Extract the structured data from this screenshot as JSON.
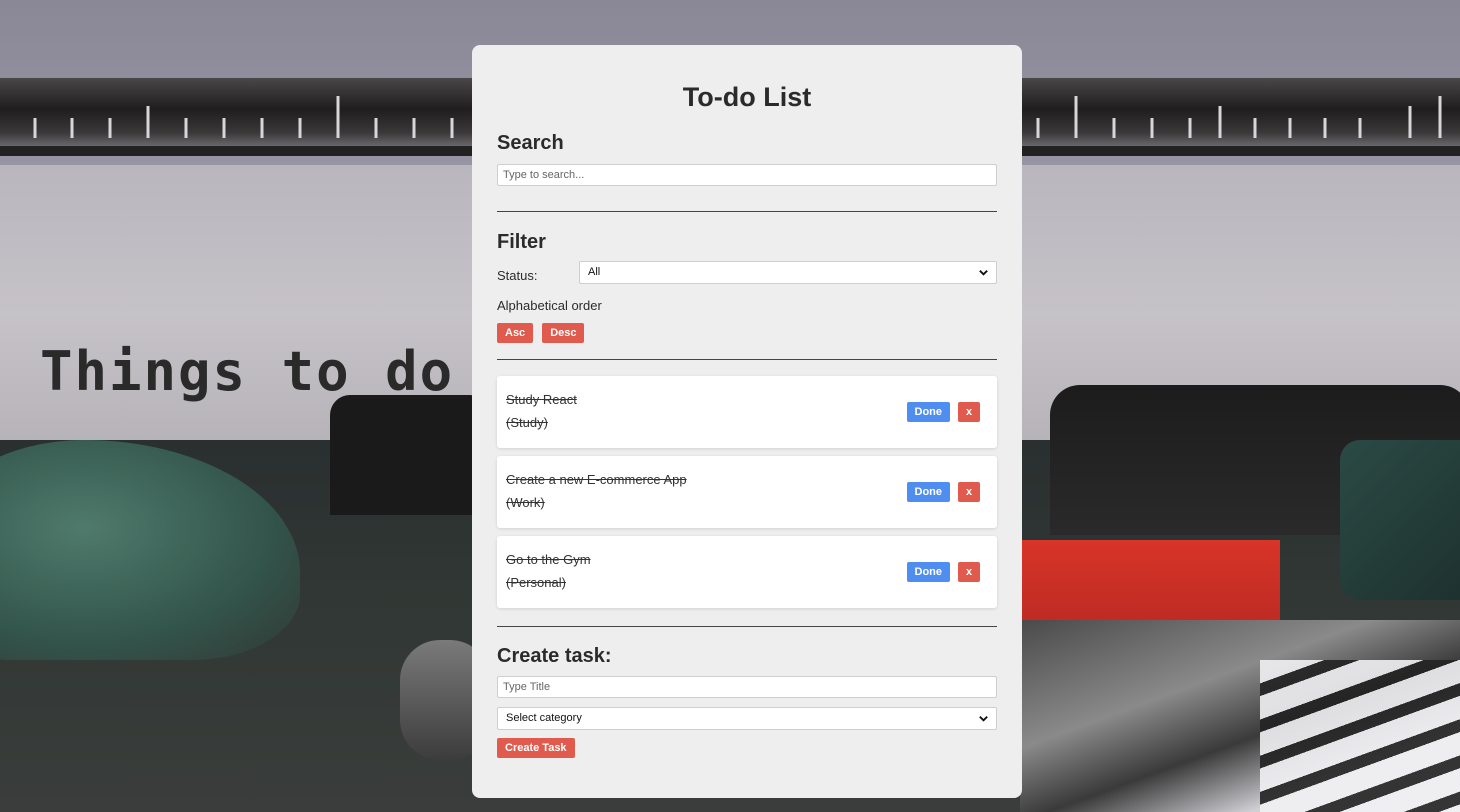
{
  "app": {
    "title": "To-do List"
  },
  "background": {
    "typed_text": "Things to do"
  },
  "search": {
    "heading": "Search",
    "placeholder": "Type to search...",
    "value": ""
  },
  "filter": {
    "heading": "Filter",
    "status_label": "Status:",
    "status_value": "All",
    "alpha_label": "Alphabetical order",
    "asc_label": "Asc",
    "desc_label": "Desc"
  },
  "tasks": [
    {
      "title": "Study React",
      "category": "(Study)",
      "done_label": "Done",
      "remove_label": "x"
    },
    {
      "title": "Create a new E-commerce App",
      "category": "(Work)",
      "done_label": "Done",
      "remove_label": "x"
    },
    {
      "title": "Go to the Gym",
      "category": "(Personal)",
      "done_label": "Done",
      "remove_label": "x"
    }
  ],
  "create": {
    "heading": "Create task:",
    "title_placeholder": "Type Title",
    "category_value": "Select category",
    "button_label": "Create Task"
  },
  "colors": {
    "card_bg": "#eeeeee",
    "accent_red": "#e05a4d",
    "accent_blue": "#4f8ef0"
  },
  "icons": {
    "select_chevron": "chevron-down-icon"
  }
}
